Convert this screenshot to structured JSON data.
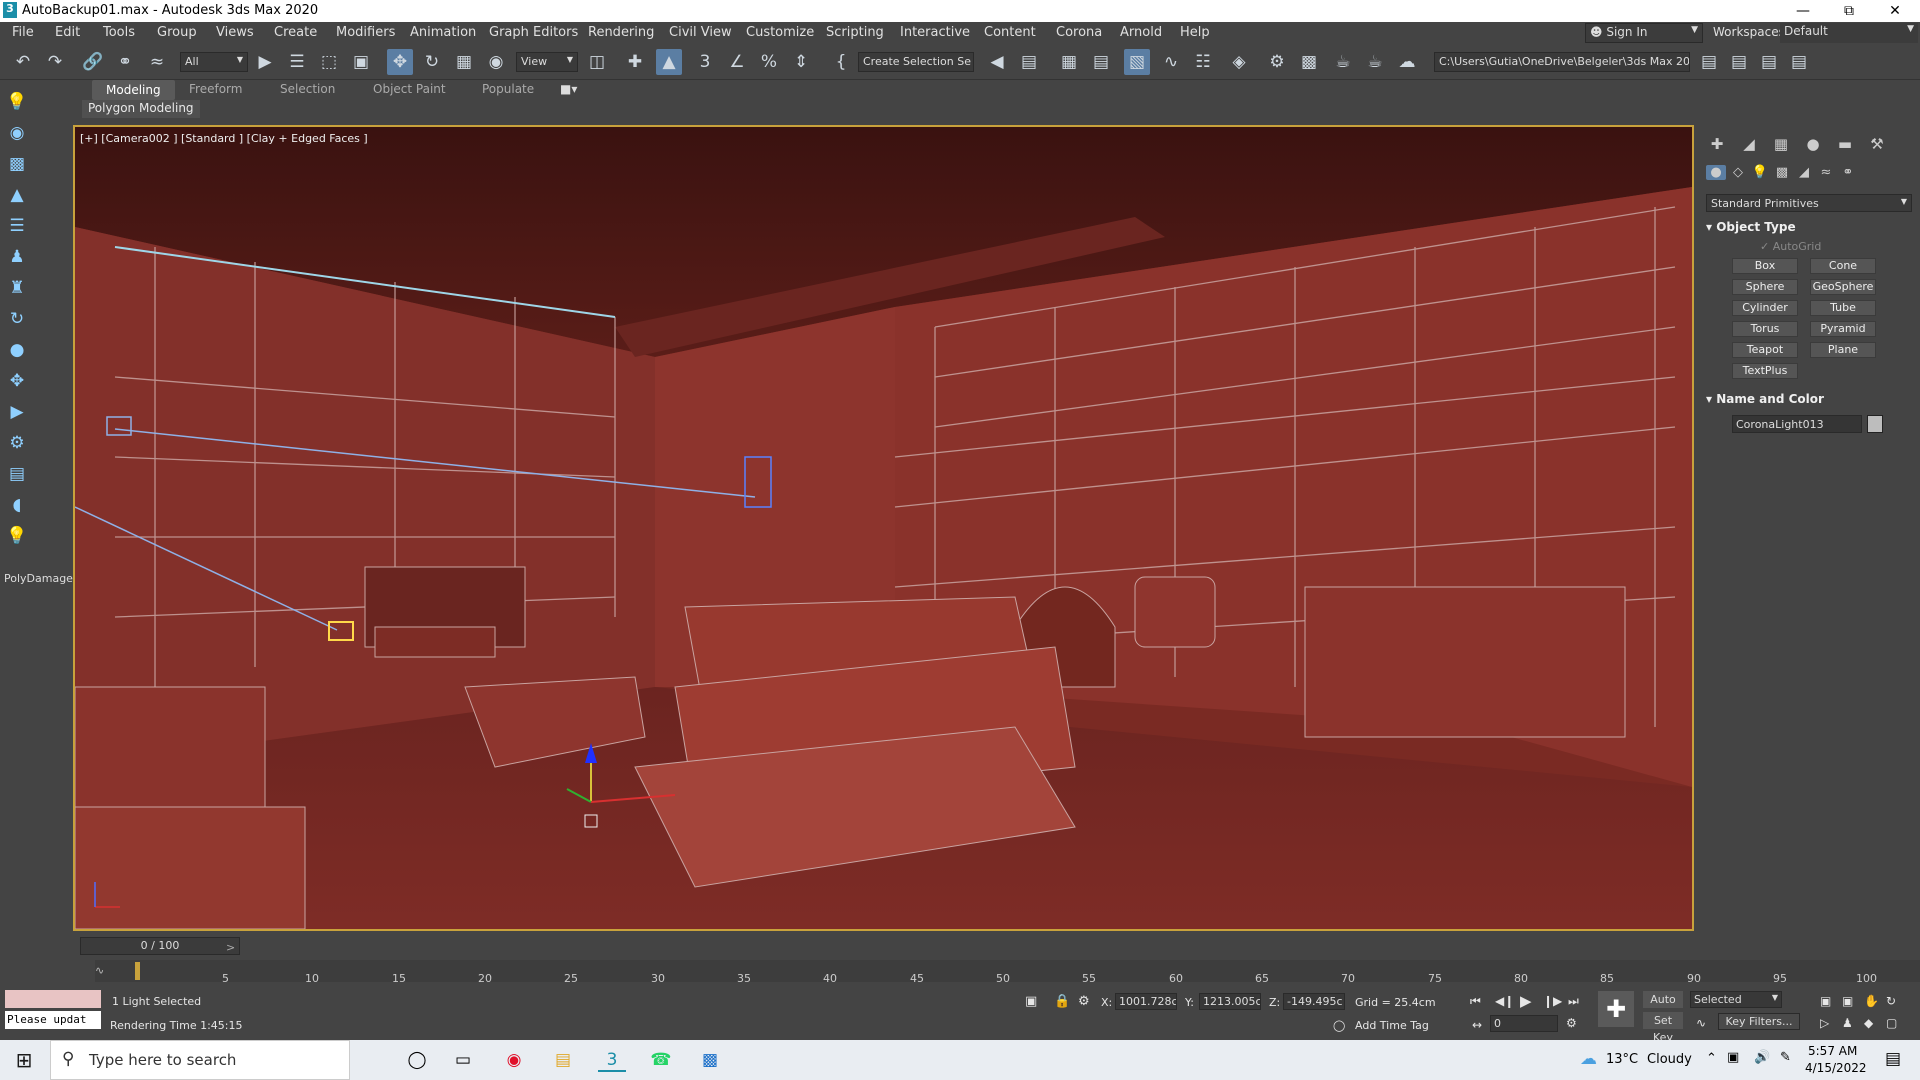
{
  "window": {
    "title": "AutoBackup01.max - Autodesk 3ds Max 2020"
  },
  "menu": [
    "File",
    "Edit",
    "Tools",
    "Group",
    "Views",
    "Create",
    "Modifiers",
    "Animation",
    "Graph Editors",
    "Rendering",
    "Civil View",
    "Customize",
    "Scripting",
    "Interactive",
    "Content",
    "Corona",
    "Arnold",
    "Help"
  ],
  "account": {
    "sign_in": "Sign In",
    "workspaces_label": "Workspaces:",
    "workspace": "Default"
  },
  "toolbar": {
    "filter": "All",
    "ref_coord": "View",
    "selection_set": "Create Selection Se",
    "project_path": "C:\\Users\\Gutia\\OneDrive\\Belgeler\\3ds Max 2020"
  },
  "ribbon": {
    "tabs": [
      "Modeling",
      "Freeform",
      "Selection",
      "Object Paint",
      "Populate"
    ],
    "active": "Modeling",
    "sub": "Polygon Modeling"
  },
  "left_toolbar": {
    "label": "PolyDamage"
  },
  "viewport": {
    "label": "[+] [Camera002 ] [Standard ] [Clay + Edged Faces ]"
  },
  "command_panel": {
    "category": "Standard Primitives",
    "object_type_title": "Object Type",
    "autogrid": "AutoGrid",
    "buttons": [
      "Box",
      "Cone",
      "Sphere",
      "GeoSphere",
      "Cylinder",
      "Tube",
      "Torus",
      "Pyramid",
      "Teapot",
      "Plane",
      "TextPlus"
    ],
    "name_color_title": "Name and Color",
    "object_name": "CoronaLight013"
  },
  "timeline": {
    "slider": "0 / 100",
    "ticks": [
      "5",
      "10",
      "15",
      "20",
      "25",
      "30",
      "35",
      "40",
      "45",
      "50",
      "55",
      "60",
      "65",
      "70",
      "75",
      "80",
      "85",
      "90",
      "95",
      "100"
    ]
  },
  "status": {
    "script_line": "Please updat",
    "selection": "1 Light Selected",
    "render_time": "Rendering Time 1:45:15",
    "x_label": "X:",
    "x": "1001.728c",
    "y_label": "Y:",
    "y": "1213.005c",
    "z_label": "Z:",
    "z": "-149.495c",
    "grid": "Grid = 25.4cm",
    "add_time_tag": "Add Time Tag",
    "auto_key": "Auto Key",
    "set_key": "Set Key",
    "key_mode": "Selected",
    "frame": "0",
    "key_filters": "Key Filters..."
  },
  "taskbar": {
    "search_placeholder": "Type here to search",
    "temp": "13°C",
    "weather": "Cloudy",
    "time": "5:57 AM",
    "date": "4/15/2022"
  }
}
